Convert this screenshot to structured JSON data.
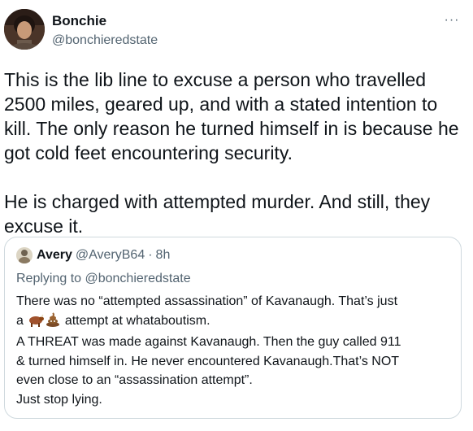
{
  "author": {
    "name": "Bonchie",
    "handle": "@bonchieredstate",
    "avatar_icon": "person-avatar"
  },
  "more_label": "···",
  "tweet": {
    "paragraphs": [
      "This is the lib line to excuse a person who travelled 2500 miles, geared up, and with a stated intention to kill. The only reason he turned himself in is because he got cold feet encountering security.",
      "He is charged with attempted murder. And still, they excuse it."
    ]
  },
  "quote": {
    "name": "Avery",
    "handle": "@AveryB64",
    "separator": "·",
    "time": "8h",
    "replying_to": "Replying to @bonchieredstate",
    "lines": {
      "l1": "There was no “attempted assassination” of Kavanaugh. That’s just",
      "l2_prefix": "a",
      "l2_suffix": "attempt at whataboutism.",
      "l3": "A THREAT was made against Kavanaugh. Then the guy called 911",
      "l4": "& turned himself in. He never encountered Kavanaugh.That’s NOT",
      "l5": "even close to an “assassination attempt”.",
      "l6": "Just stop lying."
    },
    "emojis": [
      "ox-emoji",
      "pile-of-poo-emoji"
    ]
  },
  "colors": {
    "text": "#0f1419",
    "secondary": "#536471",
    "border": "#cfd9de"
  }
}
